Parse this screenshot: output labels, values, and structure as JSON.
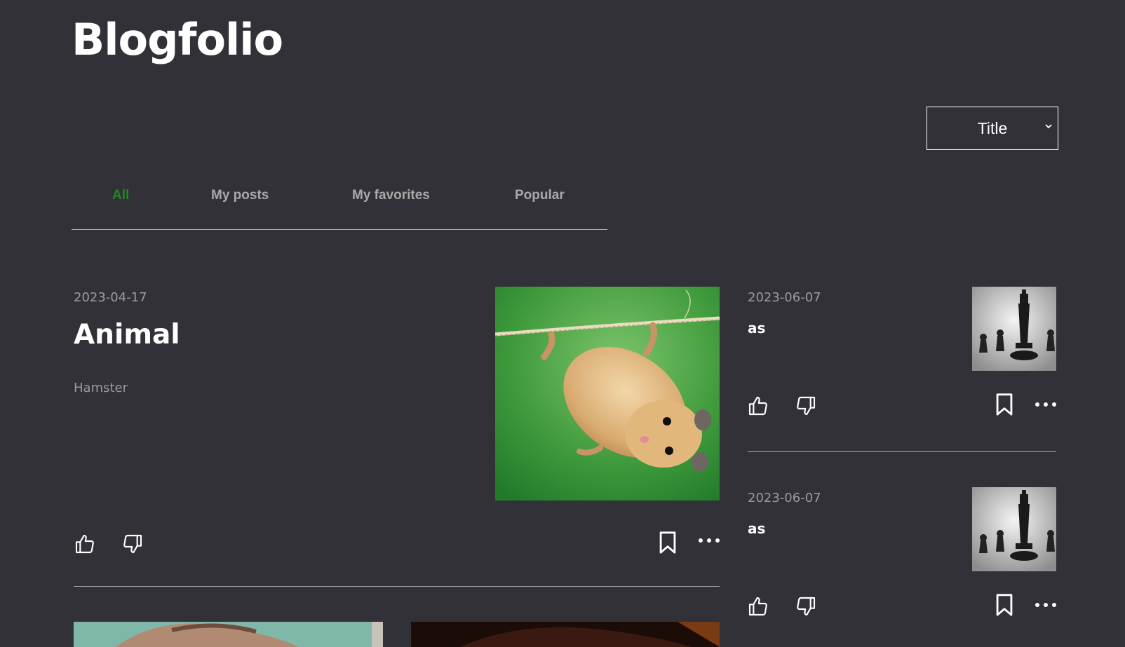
{
  "app": {
    "title": "Blogfolio"
  },
  "sort": {
    "selected": "Title",
    "icon": "chevron-down-icon"
  },
  "tabs": [
    {
      "label": "All",
      "active": true
    },
    {
      "label": "My posts",
      "active": false
    },
    {
      "label": "My favorites",
      "active": false
    },
    {
      "label": "Popular",
      "active": false
    }
  ],
  "colors": {
    "background": "#323138",
    "active_tab": "#1f8a1f",
    "muted_text": "#9b9aa3"
  },
  "main_post": {
    "date": "2023-04-17",
    "title": "Animal",
    "subtitle": "Hamster",
    "image": "hamster-hanging-on-rope"
  },
  "side_posts": [
    {
      "date": "2023-06-07",
      "title": "as",
      "image": "chess-king-and-pawns"
    },
    {
      "date": "2023-06-07",
      "title": "as",
      "image": "chess-king-and-pawns"
    }
  ],
  "icons": {
    "like": "thumbs-up-icon",
    "dislike": "thumbs-down-icon",
    "bookmark": "bookmark-icon",
    "more": "more-horizontal-icon"
  }
}
